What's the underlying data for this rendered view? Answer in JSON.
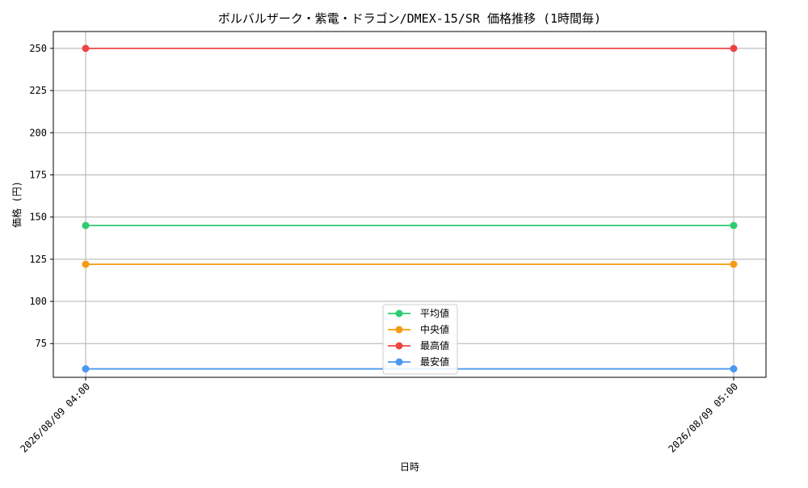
{
  "chart_data": {
    "type": "line",
    "title": "ボルバルザーク・紫電・ドラゴン/DMEX-15/SR 価格推移 (1時間毎)",
    "xlabel": "日時",
    "ylabel": "価格 (円)",
    "categories": [
      "2026/08/09 04:00",
      "2026/08/09 05:00"
    ],
    "ylim": [
      55,
      260
    ],
    "yticks": [
      75,
      100,
      125,
      150,
      175,
      200,
      225,
      250
    ],
    "grid": true,
    "legend_position": "bottom-center",
    "series": [
      {
        "name": "平均値",
        "color": "#2ecc71",
        "values": [
          145,
          145
        ]
      },
      {
        "name": "中央値",
        "color": "#f39c12",
        "values": [
          122,
          122
        ]
      },
      {
        "name": "最高値",
        "color": "#ef4444",
        "values": [
          250,
          250
        ]
      },
      {
        "name": "最安値",
        "color": "#4a98f0",
        "values": [
          60,
          60
        ]
      }
    ]
  }
}
